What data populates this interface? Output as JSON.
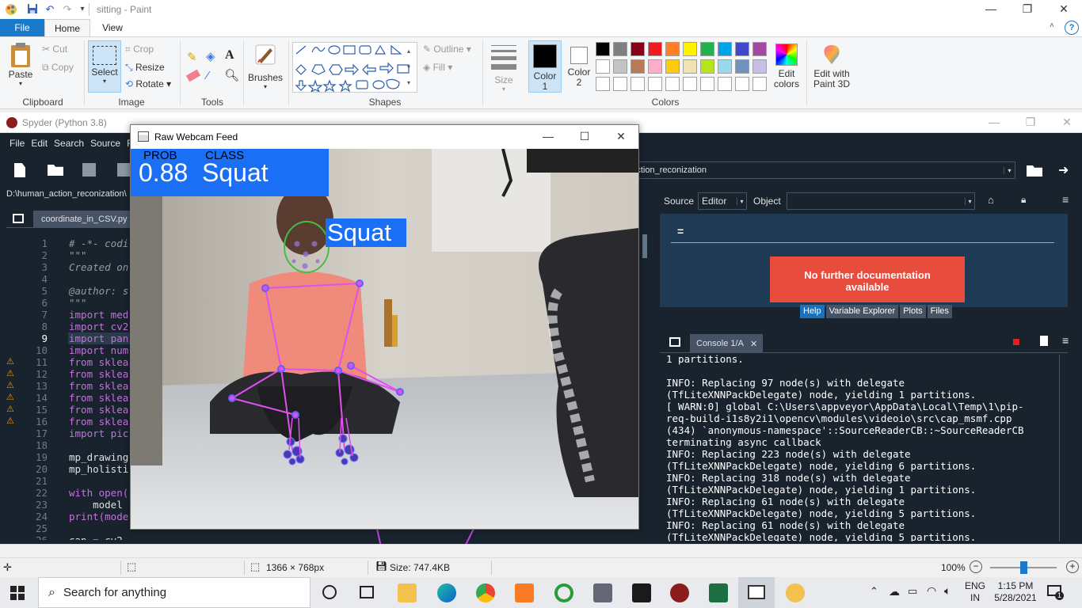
{
  "paint": {
    "title": "sitting - Paint",
    "tabs": {
      "file": "File",
      "home": "Home",
      "view": "View"
    },
    "clipboard": {
      "paste": "Paste",
      "cut": "Cut",
      "copy": "Copy",
      "group": "Clipboard"
    },
    "image": {
      "select": "Select",
      "crop": "Crop",
      "resize": "Resize",
      "rotate": "Rotate",
      "group": "Image"
    },
    "tools": {
      "group": "Tools"
    },
    "brushes": "Brushes",
    "shapes": {
      "outline": "Outline",
      "fill": "Fill",
      "group": "Shapes"
    },
    "size": "Size",
    "colors": {
      "color1": "Color\n1",
      "color1_l1": "Color",
      "color1_l2": "1",
      "color2_l1": "Color",
      "color2_l2": "2",
      "edit_l1": "Edit",
      "edit_l2": "colors",
      "group": "Colors",
      "palette_row1": [
        "#000000",
        "#7f7f7f",
        "#880015",
        "#ed1c24",
        "#ff7f27",
        "#fff200",
        "#22b14c",
        "#00a2e8",
        "#3f48cc",
        "#a349a4"
      ],
      "palette_row2": [
        "#ffffff",
        "#c3c3c3",
        "#b97a57",
        "#ffaec9",
        "#ffc90e",
        "#efe4b0",
        "#b5e61d",
        "#99d9ea",
        "#7092be",
        "#c8bfe7"
      ]
    },
    "paint3d": {
      "l1": "Edit with",
      "l2": "Paint 3D"
    }
  },
  "spyder": {
    "title": "Spyder (Python 3.8)",
    "menu": [
      "File",
      "Edit",
      "Search",
      "Source",
      "Ru"
    ],
    "path": "D:\\human_action_reconization\\",
    "path_combo": "n_action_reconization",
    "editor_tab": "coordinate_in_CSV.py",
    "line_numbers": [
      "1",
      "2",
      "3",
      "4",
      "5",
      "6",
      "7",
      "8",
      "9",
      "10",
      "11",
      "12",
      "13",
      "14",
      "15",
      "16",
      "17",
      "18",
      "19",
      "20",
      "21",
      "22",
      "23",
      "24",
      "25",
      "26"
    ],
    "code_lines": [
      "# -*- codi",
      "\"\"\"",
      "Created on",
      "",
      "@author: s",
      "\"\"\"",
      "import med",
      "import cv2",
      "import pan",
      "import num",
      "from sklea",
      "from sklea",
      "from sklea",
      "from sklea",
      "from sklea",
      "from sklea",
      "import pic",
      "",
      "mp_drawing",
      "mp_holisti",
      "",
      "with open(",
      "    model ",
      "print(mode",
      "",
      "cap = cv2"
    ],
    "help": {
      "source_label": "Source",
      "source_value": "Editor",
      "object_label": "Object",
      "heading": "=",
      "no_doc": "No further documentation available",
      "tabs": [
        "Help",
        "Variable Explorer",
        "Plots",
        "Files"
      ]
    },
    "console": {
      "tab": "Console 1/A",
      "lines": [
        "1 partitions.",
        "",
        "INFO: Replacing 97 node(s) with delegate",
        "(TfLiteXNNPackDelegate) node, yielding 1 partitions.",
        "[ WARN:0] global C:\\Users\\appveyor\\AppData\\Local\\Temp\\1\\pip-",
        "req-build-i1s8y2i1\\opencv\\modules\\videoio\\src\\cap_msmf.cpp",
        "(434) `anonymous-namespace'::SourceReaderCB::~SourceReaderCB",
        "terminating async callback",
        "INFO: Replacing 223 node(s) with delegate",
        "(TfLiteXNNPackDelegate) node, yielding 6 partitions.",
        "INFO: Replacing 318 node(s) with delegate",
        "(TfLiteXNNPackDelegate) node, yielding 1 partitions.",
        "INFO: Replacing 61 node(s) with delegate",
        "(TfLiteXNNPackDelegate) node, yielding 5 partitions.",
        "INFO: Replacing 61 node(s) with delegate",
        "(TfLiteXNNPackDelegate) node, yielding 5 partitions."
      ]
    }
  },
  "webcam": {
    "title": "Raw Webcam Feed",
    "prob_label": "PROB",
    "class_label": "CLASS",
    "prob_value": "0.88",
    "class_value": "Squat",
    "head_label": "Squat"
  },
  "statusbar": {
    "dimensions": "1366 × 768px",
    "size": "Size: 747.4KB",
    "zoom": "100%"
  },
  "taskbar": {
    "search": "Search for anything",
    "lang1": "ENG",
    "lang2": "IN",
    "time": "1:15 PM",
    "date": "5/28/2021",
    "notif": "1"
  }
}
